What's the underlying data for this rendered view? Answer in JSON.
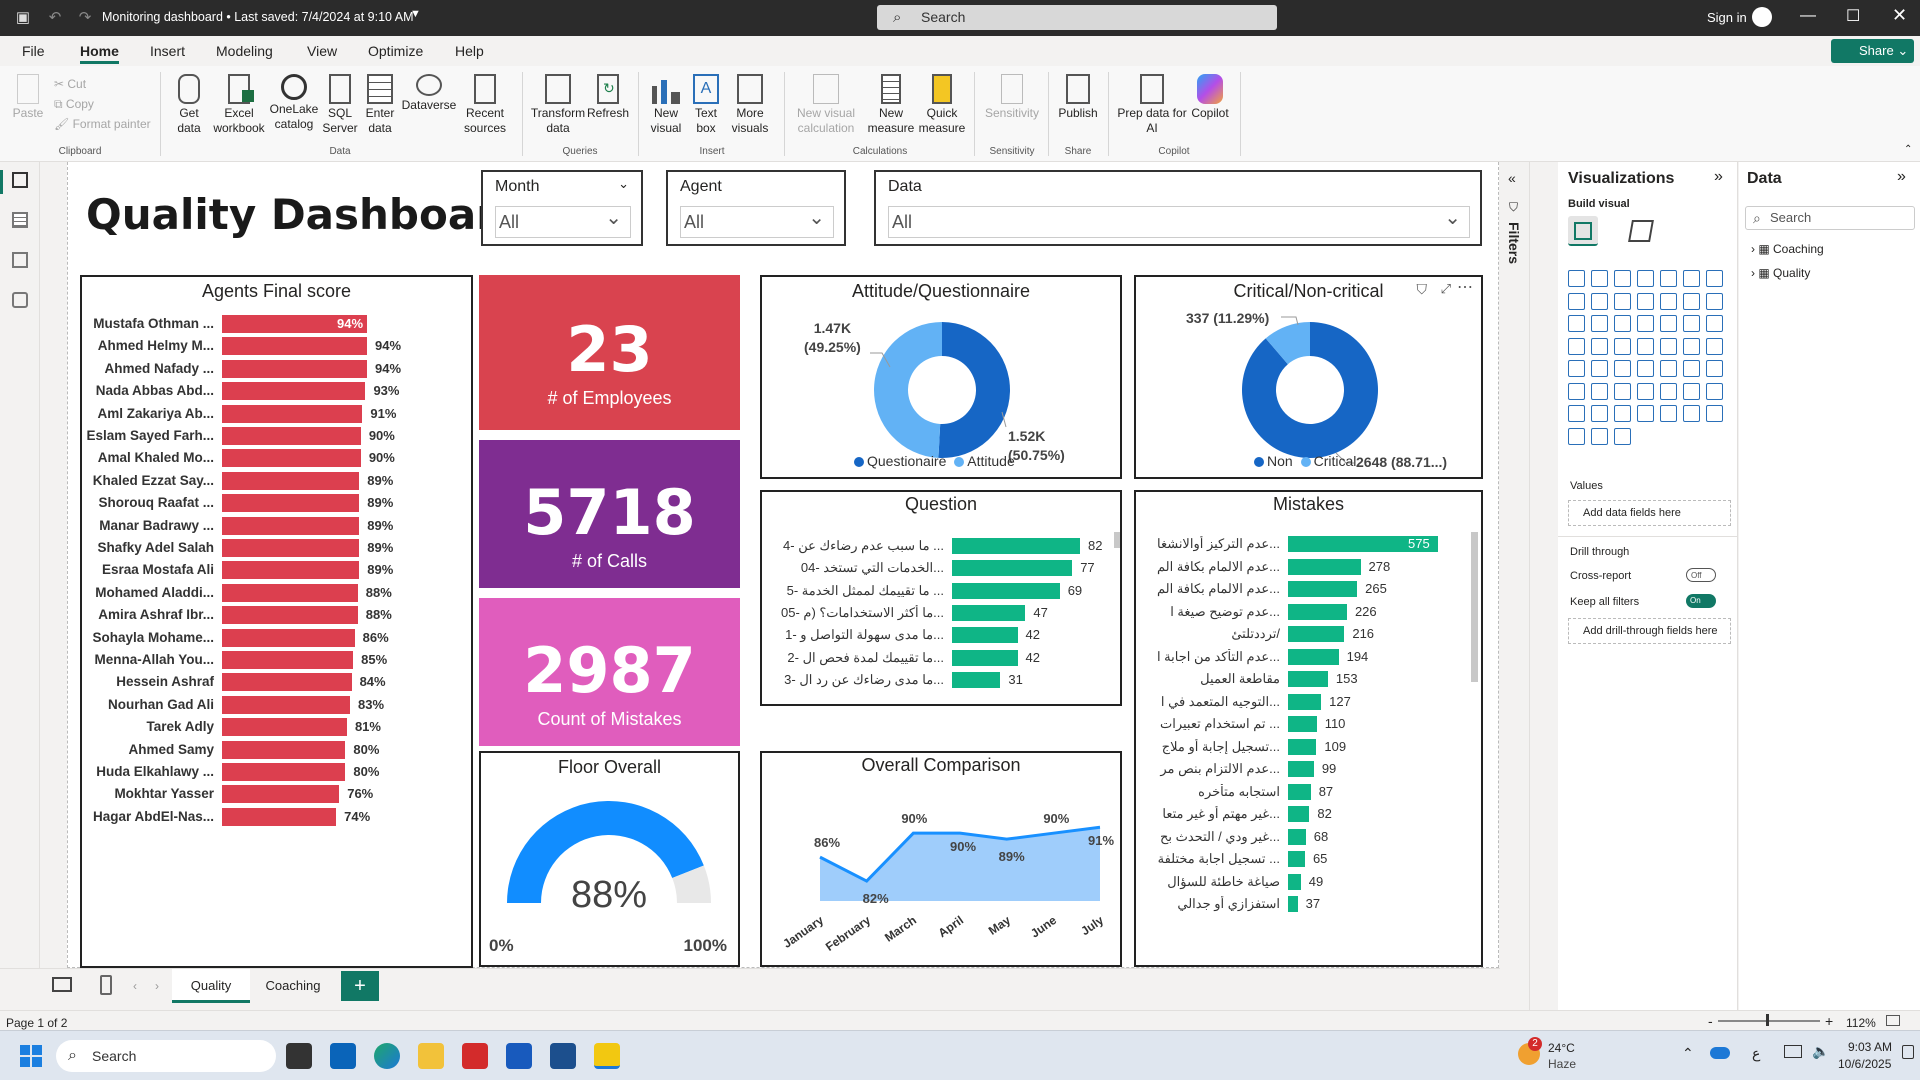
{
  "titlebar": {
    "title": "Monitoring dashboard • Last saved: 7/4/2024 at 9:10 AM",
    "search": "Search",
    "sign_in": "Sign in"
  },
  "menu": [
    "File",
    "Home",
    "Insert",
    "Modeling",
    "View",
    "Optimize",
    "Help"
  ],
  "menu_active": "Home",
  "share": "Share",
  "ribbon": {
    "clipboard": {
      "paste": "Paste",
      "cut": "Cut",
      "copy": "Copy",
      "format_painter": "Format painter",
      "group": "Clipboard"
    },
    "data": {
      "get_data": "Get data",
      "excel": "Excel workbook",
      "onelake": "OneLake catalog",
      "sql": "SQL Server",
      "enter": "Enter data",
      "dataverse": "Dataverse",
      "recent": "Recent sources",
      "group": "Data"
    },
    "queries": {
      "transform": "Transform data",
      "refresh": "Refresh",
      "group": "Queries"
    },
    "insert": {
      "new_visual": "New visual",
      "text_box": "Text box",
      "more_visuals": "More visuals",
      "group": "Insert"
    },
    "calculations": {
      "new_visual_calc": "New visual calculation",
      "new_measure": "New measure",
      "quick_measure": "Quick measure",
      "group": "Calculations"
    },
    "sensitivity": {
      "sensitivity": "Sensitivity",
      "group": "Sensitivity"
    },
    "share": {
      "publish": "Publish",
      "group": "Share"
    },
    "copilot": {
      "prep": "Prep data for AI",
      "copilot": "Copilot",
      "group": "Copilot"
    }
  },
  "dashboard": {
    "title": "Quality Dashboard",
    "slicers": [
      {
        "label": "Month",
        "value": "All"
      },
      {
        "label": "Agent",
        "value": "All"
      },
      {
        "label": "Data",
        "value": "All"
      }
    ],
    "kpis": [
      {
        "value": "23",
        "label": "# of Employees",
        "color": "#d9434f"
      },
      {
        "value": "5718",
        "label": "# of Calls",
        "color": "#7f2d91"
      },
      {
        "value": "2987",
        "label": "Count of Mistakes",
        "color": "#e05dbd"
      }
    ]
  },
  "chart_data": [
    {
      "type": "bar",
      "title": "Agents Final score",
      "categories": [
        "Mustafa Othman ...",
        "Ahmed Helmy M...",
        "Ahmed Nafady ...",
        "Nada Abbas Abd...",
        "Aml Zakariya Ab...",
        "Eslam Sayed Farh...",
        "Amal Khaled Mo...",
        "Khaled Ezzat Say...",
        "Shorouq Raafat ...",
        "Manar Badrawy ...",
        "Shafky Adel Salah",
        "Esraa Mostafa Ali",
        "Mohamed Aladdi...",
        "Amira Ashraf Ibr...",
        "Sohayla Mohame...",
        "Menna-Allah You...",
        "Hessein Ashraf",
        "Nourhan Gad Ali",
        "Tarek Adly",
        "Ahmed Samy",
        "Huda Elkahlawy ...",
        "Mokhtar Yasser",
        "Hagar AbdEl-Nas..."
      ],
      "values": [
        94,
        94,
        94,
        93,
        91,
        90,
        90,
        89,
        89,
        89,
        89,
        89,
        88,
        88,
        86,
        85,
        84,
        83,
        81,
        80,
        80,
        76,
        74
      ],
      "labels": [
        "94%",
        "94%",
        "94%",
        "93%",
        "91%",
        "90%",
        "90%",
        "89%",
        "89%",
        "89%",
        "89%",
        "89%",
        "88%",
        "88%",
        "86%",
        "85%",
        "84%",
        "83%",
        "81%",
        "80%",
        "80%",
        "76%",
        "74%"
      ],
      "color": "#dc3f4f"
    },
    {
      "type": "pie",
      "title": "Attitude/Questionnaire",
      "categories": [
        "Questionaire",
        "Attitude"
      ],
      "values": [
        1520,
        1470
      ],
      "labels": [
        "1.52K\n(50.75%)",
        "1.47K\n(49.25%)"
      ],
      "colors": [
        "#1666c5",
        "#62b2f5"
      ]
    },
    {
      "type": "pie",
      "title": "Critical/Non-critical",
      "categories": [
        "Non",
        "Critical"
      ],
      "values": [
        2648,
        337
      ],
      "labels": [
        "2648 (88.71...)",
        "337 (11.29%)"
      ],
      "colors": [
        "#1666c5",
        "#62b2f5"
      ]
    },
    {
      "type": "bar",
      "title": "Question",
      "categories": [
        "4- ما سبب عدم رضاءك عن ...",
        "04- الخدمات التي تستخد...",
        "5- ما تقييمك لممثل الخدمة ...",
        "05- ما أكثر الاستخدامات؟ (م...",
        "1- ما مدى سهولة التواصل و...",
        "2- ما تقييمك لمدة فحص ال...",
        "3- ما مدى رضاءك عن رد ال..."
      ],
      "values": [
        82,
        77,
        69,
        47,
        42,
        42,
        31
      ],
      "color": "#0fb586"
    },
    {
      "type": "bar",
      "title": "Mistakes",
      "categories": [
        "عدم التركيز أوالانشغا...",
        "عدم الالمام بكافة الم...",
        "عدم الالمام بكافة الم...",
        "عدم توضيح صيغة ا...",
        "ترددتلتئ/",
        "عدم التأكد من اجابة ا...",
        "مقاطعة العميل",
        "التوجيه المتعمد في ا...",
        "تم استخدام تعبيرات ...",
        "تسجيل إجابة أو ملاج...",
        "عدم الالتزام بنص مر...",
        "استجابه متأخره",
        "غير مهتم أو غير متعا...",
        "غير ودي / التحدث بح...",
        "تسجيل اجابة مختلفة ...",
        "صياغة خاطئة للسؤال",
        "استفزازي أو جدالي"
      ],
      "values": [
        575,
        278,
        265,
        226,
        216,
        194,
        153,
        127,
        110,
        109,
        99,
        87,
        82,
        68,
        65,
        49,
        37
      ],
      "color": "#0fb586"
    },
    {
      "type": "pie",
      "title": "Floor Overall",
      "values": [
        88
      ],
      "labels": [
        "88%",
        "0%",
        "100%"
      ],
      "ylim": [
        0,
        100
      ],
      "colors": [
        "#118dff",
        "#e8e8e8"
      ]
    },
    {
      "type": "area",
      "title": "Overall Comparison",
      "categories": [
        "January",
        "February",
        "March",
        "April",
        "May",
        "June",
        "July"
      ],
      "values": [
        86,
        82,
        90,
        90,
        89,
        90,
        91
      ],
      "labels": [
        "86%",
        "82%",
        "90%",
        "90%",
        "89%",
        "90%",
        "91%"
      ],
      "colors": [
        "#1890ff",
        "#9fcdfb"
      ]
    }
  ],
  "viz_pane": {
    "title": "Visualizations",
    "build": "Build visual",
    "values": "Values",
    "add_data": "Add data fields here",
    "drill": "Drill through",
    "cross": "Cross-report",
    "cross_state": "Off",
    "keep": "Keep all filters",
    "keep_state": "On",
    "add_drill": "Add drill-through fields here"
  },
  "filters_label": "Filters",
  "data_pane": {
    "title": "Data",
    "search": "Search",
    "tables": [
      "Coaching",
      "Quality"
    ]
  },
  "tabs": [
    "Quality",
    "Coaching"
  ],
  "active_tab": "Quality",
  "status": {
    "page": "Page 1 of 2",
    "zoom": "112%"
  },
  "taskbar": {
    "search": "Search",
    "weather": "24°C",
    "weather_desc": "Haze",
    "badge": "2",
    "time": "9:03 AM",
    "date": "10/6/2025",
    "lang": "ع"
  }
}
